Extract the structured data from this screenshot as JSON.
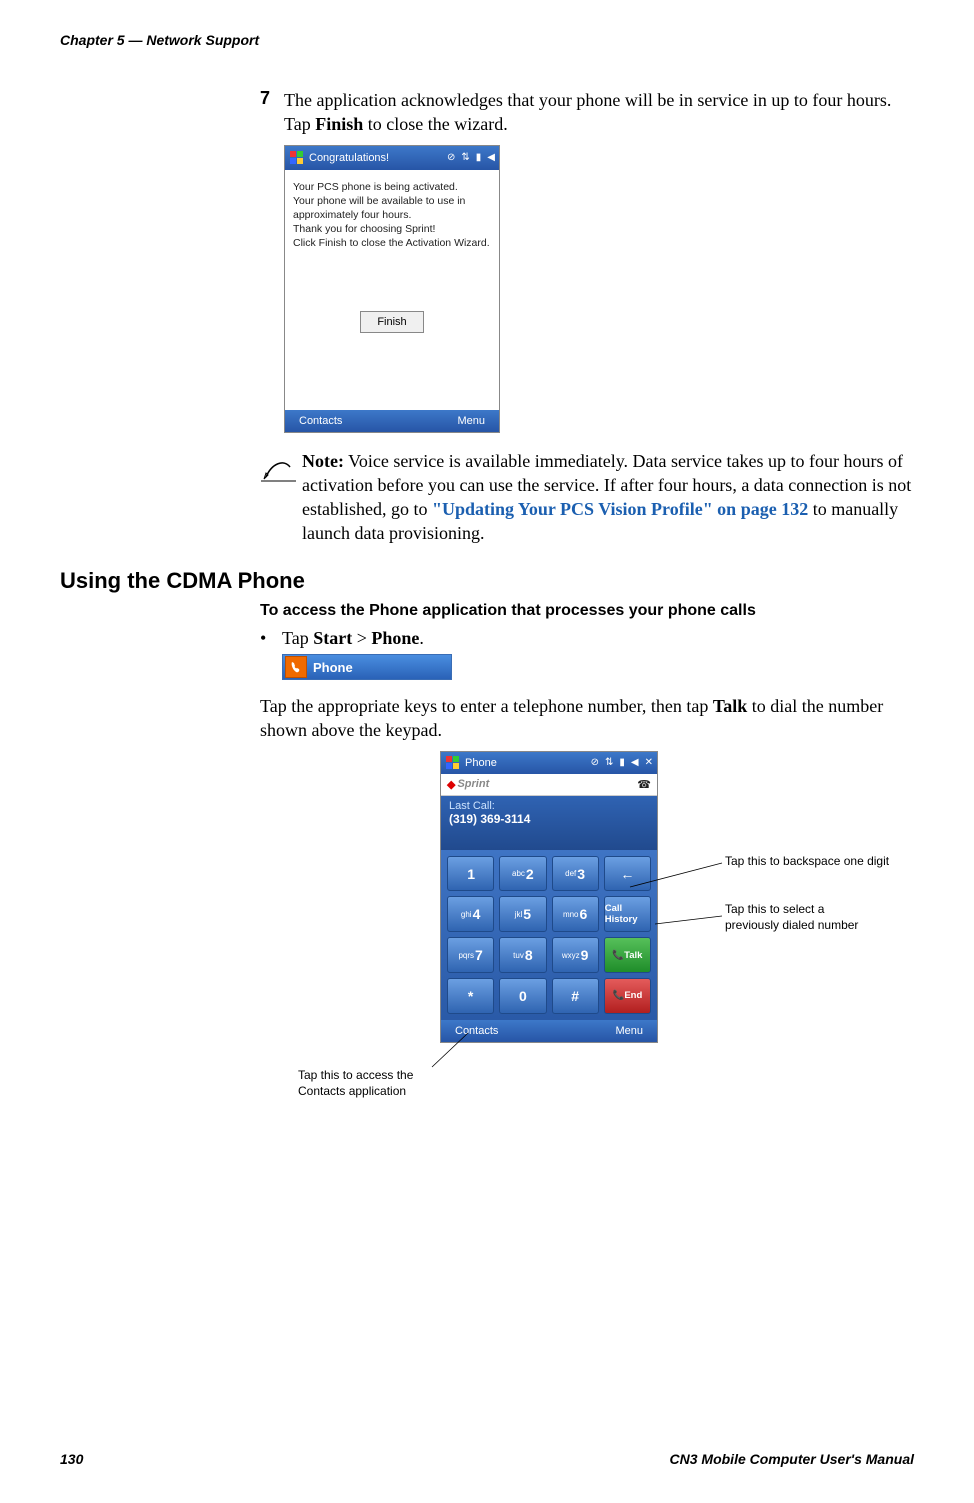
{
  "header": {
    "chapter": "Chapter 5 — Network Support"
  },
  "footer": {
    "page": "130",
    "manual": "CN3 Mobile Computer User's Manual"
  },
  "step": {
    "num": "7",
    "text_a": "The application acknowledges that your phone will be in service in up to four hours. Tap ",
    "text_b": "Finish",
    "text_c": " to close the wizard."
  },
  "ss1": {
    "title": "Congratulations!",
    "body_l1": "Your PCS phone is being activated.",
    "body_l2": "Your phone will be available to use in",
    "body_l3": "approximately four hours.",
    "body_l4": "Thank you for choosing Sprint!",
    "body_l5": "Click Finish to close the Activation Wizard.",
    "btn": "Finish",
    "soft_left": "Contacts",
    "soft_right": "Menu"
  },
  "note": {
    "label": "Note:",
    "text_a": " Voice service is available immediately. Data service takes up to four hours of activation before you can use the service. If after four hours, a data connection is not established, go to ",
    "link": "\"Updating Your PCS Vision Profile\" on page 132",
    "text_b": " to manually launch data provisioning."
  },
  "h2": "Using the CDMA Phone",
  "h3": "To access the Phone application that processes your phone calls",
  "bullet": {
    "a": "Tap ",
    "b": "Start",
    "c": " > ",
    "d": "Phone",
    "e": "."
  },
  "phonestrip": {
    "label": "Phone"
  },
  "para": {
    "a": "Tap the appropriate keys to enter a telephone number, then tap ",
    "b": "Talk",
    "c": " to dial the number shown above the keypad."
  },
  "ss2": {
    "title": "Phone",
    "carrier": "Sprint",
    "last_call_label": "Last Call:",
    "last_call_num": "(319) 369-3114",
    "soft_left": "Contacts",
    "soft_right": "Menu",
    "keys": {
      "k1": {
        "pre": "",
        "big": "1"
      },
      "k2": {
        "pre": "abc",
        "big": "2"
      },
      "k3": {
        "pre": "def",
        "big": "3"
      },
      "k4": {
        "pre": "ghi",
        "big": "4"
      },
      "k5": {
        "pre": "jkl",
        "big": "5"
      },
      "k6": {
        "pre": "mno",
        "big": "6"
      },
      "k7": {
        "pre": "pqrs",
        "big": "7"
      },
      "k8": {
        "pre": "tuv",
        "big": "8"
      },
      "k9": {
        "pre": "wxyz",
        "big": "9"
      },
      "kstar": {
        "pre": "",
        "big": "*"
      },
      "k0": {
        "pre": "",
        "big": "0"
      },
      "kpound": {
        "pre": "",
        "big": "#"
      },
      "back": "←",
      "callhist": "Call History",
      "talk": "Talk",
      "end": "End"
    }
  },
  "callouts": {
    "backspace": "Tap this to backspace one digit",
    "callhist_a": "Tap this to select a",
    "callhist_b": "previously dialed number",
    "contacts_a": "Tap this to access the",
    "contacts_b": "Contacts application"
  }
}
